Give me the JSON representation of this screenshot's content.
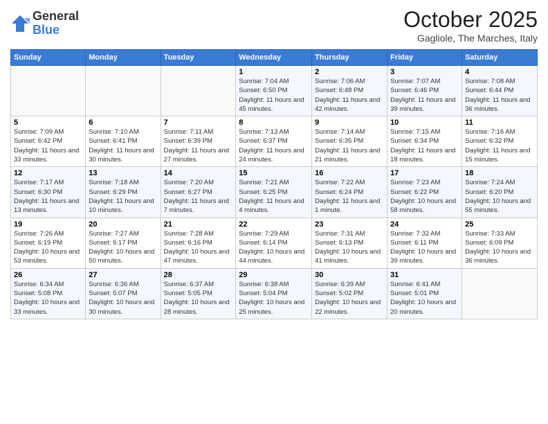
{
  "header": {
    "logo_general": "General",
    "logo_blue": "Blue",
    "month_title": "October 2025",
    "location": "Gagliole, The Marches, Italy"
  },
  "days_of_week": [
    "Sunday",
    "Monday",
    "Tuesday",
    "Wednesday",
    "Thursday",
    "Friday",
    "Saturday"
  ],
  "weeks": [
    [
      {
        "day": "",
        "info": ""
      },
      {
        "day": "",
        "info": ""
      },
      {
        "day": "",
        "info": ""
      },
      {
        "day": "1",
        "info": "Sunrise: 7:04 AM\nSunset: 6:50 PM\nDaylight: 11 hours and 45 minutes."
      },
      {
        "day": "2",
        "info": "Sunrise: 7:06 AM\nSunset: 6:48 PM\nDaylight: 11 hours and 42 minutes."
      },
      {
        "day": "3",
        "info": "Sunrise: 7:07 AM\nSunset: 6:46 PM\nDaylight: 11 hours and 39 minutes."
      },
      {
        "day": "4",
        "info": "Sunrise: 7:08 AM\nSunset: 6:44 PM\nDaylight: 11 hours and 36 minutes."
      }
    ],
    [
      {
        "day": "5",
        "info": "Sunrise: 7:09 AM\nSunset: 6:42 PM\nDaylight: 11 hours and 33 minutes."
      },
      {
        "day": "6",
        "info": "Sunrise: 7:10 AM\nSunset: 6:41 PM\nDaylight: 11 hours and 30 minutes."
      },
      {
        "day": "7",
        "info": "Sunrise: 7:11 AM\nSunset: 6:39 PM\nDaylight: 11 hours and 27 minutes."
      },
      {
        "day": "8",
        "info": "Sunrise: 7:13 AM\nSunset: 6:37 PM\nDaylight: 11 hours and 24 minutes."
      },
      {
        "day": "9",
        "info": "Sunrise: 7:14 AM\nSunset: 6:35 PM\nDaylight: 11 hours and 21 minutes."
      },
      {
        "day": "10",
        "info": "Sunrise: 7:15 AM\nSunset: 6:34 PM\nDaylight: 11 hours and 18 minutes."
      },
      {
        "day": "11",
        "info": "Sunrise: 7:16 AM\nSunset: 6:32 PM\nDaylight: 11 hours and 15 minutes."
      }
    ],
    [
      {
        "day": "12",
        "info": "Sunrise: 7:17 AM\nSunset: 6:30 PM\nDaylight: 11 hours and 13 minutes."
      },
      {
        "day": "13",
        "info": "Sunrise: 7:18 AM\nSunset: 6:29 PM\nDaylight: 11 hours and 10 minutes."
      },
      {
        "day": "14",
        "info": "Sunrise: 7:20 AM\nSunset: 6:27 PM\nDaylight: 11 hours and 7 minutes."
      },
      {
        "day": "15",
        "info": "Sunrise: 7:21 AM\nSunset: 6:25 PM\nDaylight: 11 hours and 4 minutes."
      },
      {
        "day": "16",
        "info": "Sunrise: 7:22 AM\nSunset: 6:24 PM\nDaylight: 11 hours and 1 minute."
      },
      {
        "day": "17",
        "info": "Sunrise: 7:23 AM\nSunset: 6:22 PM\nDaylight: 10 hours and 58 minutes."
      },
      {
        "day": "18",
        "info": "Sunrise: 7:24 AM\nSunset: 6:20 PM\nDaylight: 10 hours and 55 minutes."
      }
    ],
    [
      {
        "day": "19",
        "info": "Sunrise: 7:26 AM\nSunset: 6:19 PM\nDaylight: 10 hours and 53 minutes."
      },
      {
        "day": "20",
        "info": "Sunrise: 7:27 AM\nSunset: 6:17 PM\nDaylight: 10 hours and 50 minutes."
      },
      {
        "day": "21",
        "info": "Sunrise: 7:28 AM\nSunset: 6:16 PM\nDaylight: 10 hours and 47 minutes."
      },
      {
        "day": "22",
        "info": "Sunrise: 7:29 AM\nSunset: 6:14 PM\nDaylight: 10 hours and 44 minutes."
      },
      {
        "day": "23",
        "info": "Sunrise: 7:31 AM\nSunset: 6:13 PM\nDaylight: 10 hours and 41 minutes."
      },
      {
        "day": "24",
        "info": "Sunrise: 7:32 AM\nSunset: 6:11 PM\nDaylight: 10 hours and 39 minutes."
      },
      {
        "day": "25",
        "info": "Sunrise: 7:33 AM\nSunset: 6:09 PM\nDaylight: 10 hours and 36 minutes."
      }
    ],
    [
      {
        "day": "26",
        "info": "Sunrise: 6:34 AM\nSunset: 5:08 PM\nDaylight: 10 hours and 33 minutes."
      },
      {
        "day": "27",
        "info": "Sunrise: 6:36 AM\nSunset: 5:07 PM\nDaylight: 10 hours and 30 minutes."
      },
      {
        "day": "28",
        "info": "Sunrise: 6:37 AM\nSunset: 5:05 PM\nDaylight: 10 hours and 28 minutes."
      },
      {
        "day": "29",
        "info": "Sunrise: 6:38 AM\nSunset: 5:04 PM\nDaylight: 10 hours and 25 minutes."
      },
      {
        "day": "30",
        "info": "Sunrise: 6:39 AM\nSunset: 5:02 PM\nDaylight: 10 hours and 22 minutes."
      },
      {
        "day": "31",
        "info": "Sunrise: 6:41 AM\nSunset: 5:01 PM\nDaylight: 10 hours and 20 minutes."
      },
      {
        "day": "",
        "info": ""
      }
    ]
  ]
}
